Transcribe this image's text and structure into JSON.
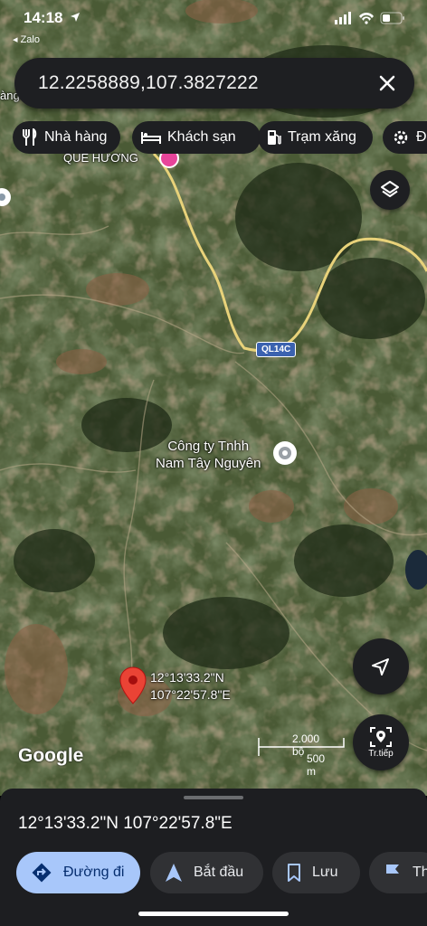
{
  "status_bar": {
    "time": "14:18",
    "back_app": "◂ Zalo"
  },
  "search": {
    "value": "12.2258889,107.3827222"
  },
  "chips": [
    {
      "label": "Nhà hàng",
      "icon": "restaurant-icon"
    },
    {
      "label": "Khách sạn",
      "icon": "hotel-icon"
    },
    {
      "label": "Trạm xăng",
      "icon": "gas-station-icon"
    },
    {
      "label": "Đi",
      "icon": "gear-icon"
    }
  ],
  "map": {
    "labels": {
      "place_top": "QUE HƯƠNG",
      "place_edge": "àng",
      "road_shield": "QL14C",
      "company": "Công ty Tnhh\nNam Tây Nguyên",
      "pin_coords": "12°13'33.2\"N\n107°22'57.8\"E"
    },
    "scale": {
      "imperial": "2.000 bộ",
      "metric": "500 m"
    },
    "attribution": "Google",
    "street_view_label": "Tr.tiếp"
  },
  "sheet": {
    "coords": "12°13'33.2\"N 107°22'57.8\"E",
    "actions": [
      {
        "label": "Đường đi",
        "icon": "directions-icon"
      },
      {
        "label": "Bắt đầu",
        "icon": "navigation-arrow-icon"
      },
      {
        "label": "Lưu",
        "icon": "bookmark-icon"
      },
      {
        "label": "Th",
        "icon": "flag-icon"
      }
    ]
  },
  "colors": {
    "accent": "#a8c7fa",
    "pin": "#ea4335",
    "road": "#e8d27a",
    "surface": "#1e1f22"
  }
}
